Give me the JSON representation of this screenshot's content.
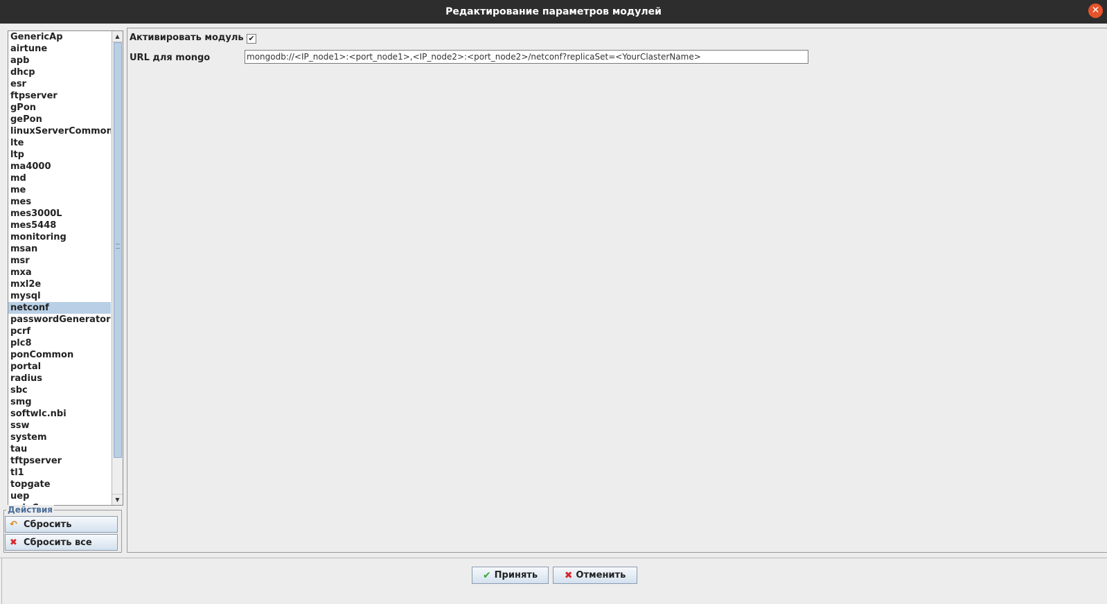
{
  "window": {
    "title": "Редактирование параметров модулей",
    "close_glyph": "✕"
  },
  "modules": [
    "GenericAp",
    "airtune",
    "apb",
    "dhcp",
    "esr",
    "ftpserver",
    "gPon",
    "gePon",
    "linuxServerCommon",
    "lte",
    "ltp",
    "ma4000",
    "md",
    "me",
    "mes",
    "mes3000L",
    "mes5448",
    "monitoring",
    "msan",
    "msr",
    "mxa",
    "mxl2e",
    "mysql",
    "netconf",
    "passwordGenerator",
    "pcrf",
    "plc8",
    "ponCommon",
    "portal",
    "radius",
    "sbc",
    "smg",
    "softwlc.nbi",
    "ssw",
    "system",
    "tau",
    "tftpserver",
    "tl1",
    "topgate",
    "uep",
    "voipCommon"
  ],
  "selected_module": "netconf",
  "actions": {
    "legend": "Действия",
    "reset_label": "Сбросить",
    "reset_all_label": "Сбросить все",
    "reset_icon": "undo-arrow-icon",
    "reset_all_icon": "red-x-icon"
  },
  "settings": {
    "activate_label": "Активировать модуль",
    "activate_checked": true,
    "url_label": "URL для mongo",
    "url_value": "mongodb://<IP_node1>:<port_node1>,<IP_node2>:<port_node2>/netconf?replicaSet=<YourClasterName>"
  },
  "dialog_buttons": {
    "accept_label": "Принять",
    "cancel_label": "Отменить",
    "accept_icon": "check-icon",
    "cancel_icon": "red-x-icon"
  },
  "colors": {
    "title_bar": "#2d2d2d",
    "close_button": "#e7532b",
    "selection": "#b8cfe5"
  }
}
